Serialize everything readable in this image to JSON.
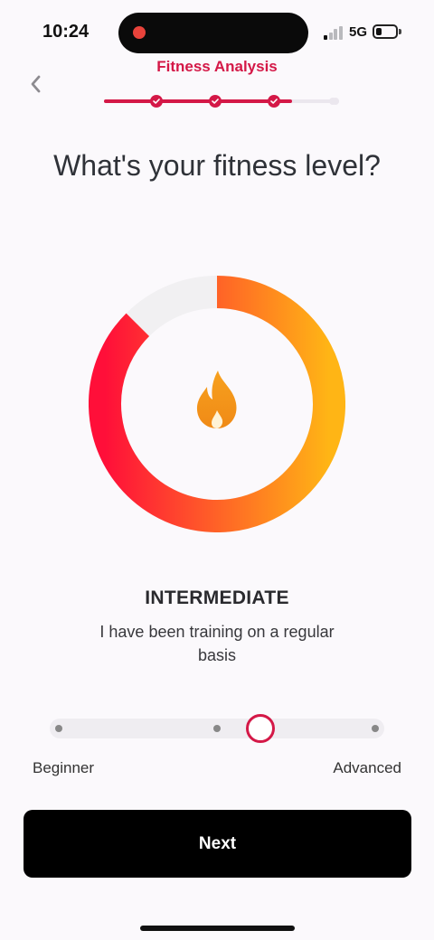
{
  "status_bar": {
    "time": "10:24",
    "network": "5G",
    "signal_bars_active": 1,
    "signal_bars_total": 4,
    "battery_level": 0.3
  },
  "header": {
    "title": "Fitness Analysis",
    "back_icon": "chevron-left-icon",
    "progress": {
      "total_steps": 5,
      "completed_steps": 3,
      "fraction": 0.8
    }
  },
  "question": "What's your fitness level?",
  "gauge": {
    "value_fraction": 0.875,
    "icon": "flame-icon",
    "colors": {
      "start": "#ff0f39",
      "end": "#ffb515",
      "track": "#f1f0f2"
    }
  },
  "level": {
    "title": "INTERMEDIATE",
    "description": "I have been training on a regular basis"
  },
  "slider": {
    "min_label": "Beginner",
    "max_label": "Advanced",
    "stops": 3,
    "value_fraction": 0.63
  },
  "next_button": {
    "label": "Next"
  },
  "colors": {
    "accent": "#d41847",
    "button": "#000000",
    "background": "#fbf9fc"
  }
}
